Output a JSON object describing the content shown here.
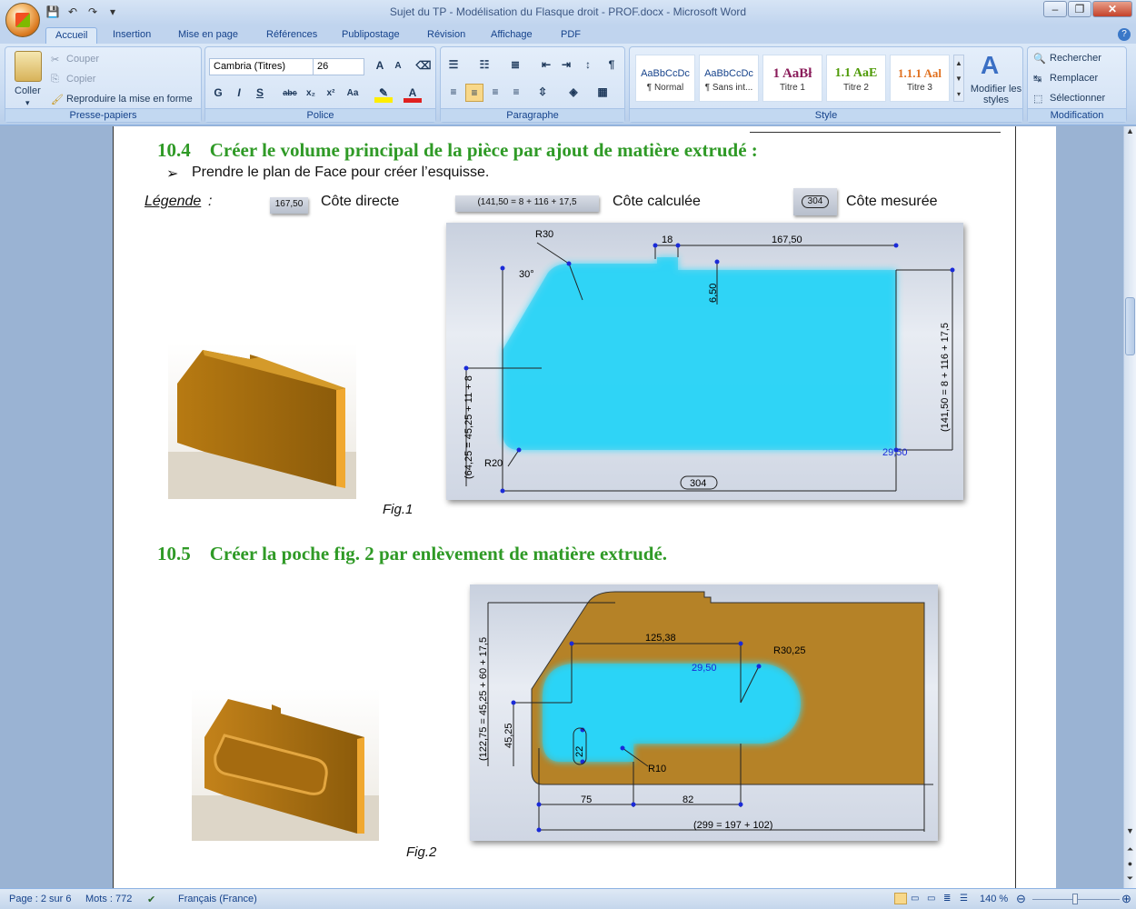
{
  "window": {
    "title": "Sujet du TP - Modélisation du Flasque droit - PROF.docx - Microsoft Word"
  },
  "tabs": [
    "Accueil",
    "Insertion",
    "Mise en page",
    "Références",
    "Publipostage",
    "Révision",
    "Affichage",
    "PDF"
  ],
  "ribbon": {
    "clipboard": {
      "label": "Presse-papiers",
      "paste": "Coller",
      "cut": "Couper",
      "copy": "Copier",
      "format_painter": "Reproduire la mise en forme"
    },
    "font": {
      "label": "Police",
      "family": "Cambria (Titres)",
      "size": "26"
    },
    "paragraph": {
      "label": "Paragraphe"
    },
    "styles": {
      "label": "Style",
      "items": [
        {
          "preview": "AaBbCcDc",
          "name": "¶ Normal",
          "color": "#000000"
        },
        {
          "preview": "AaBbCcDc",
          "name": "¶ Sans int...",
          "color": "#000000"
        },
        {
          "preview": "1  AaBł",
          "name": "Titre 1",
          "color": "#8a1c5a"
        },
        {
          "preview": "1.1  AaE",
          "name": "Titre 2",
          "color": "#4e9a06"
        },
        {
          "preview": "1.1.1  Aal",
          "name": "Titre 3",
          "color": "#e07020"
        }
      ],
      "modify": "Modifier les styles"
    },
    "editing": {
      "label": "Modification",
      "find": "Rechercher",
      "replace": "Remplacer",
      "select": "Sélectionner"
    }
  },
  "doc": {
    "h1": {
      "num": "10.4",
      "text": "Créer le volume principal de la pièce par ajout de matière extrudé :"
    },
    "bullet": "Prendre le plan de Face pour créer l’esquisse.",
    "legend": {
      "title": "Légende",
      "colon": ":",
      "direct_box": "167,50",
      "direct": "Côte directe",
      "calc_box": "(141,50 = 8 + 116 + 17,5",
      "calc": "Côte calculée",
      "meas_box": "304",
      "meas": "Côte mesurée"
    },
    "fig1": {
      "caption": "Fig.1",
      "dims": {
        "r30": "R30",
        "d18": "18",
        "d167": "167,50",
        "d30deg": "30°",
        "d650": "6,50",
        "left": "(64,25 = 45,25 + 11 + 8",
        "right": "(141,50 = 8 + 116 + 17,5",
        "r20": "R20",
        "d2950": "29,50",
        "d304": "304"
      }
    },
    "h2": {
      "num": "10.5",
      "text": "Créer la poche fig. 2 par enlèvement de matière extrudé."
    },
    "fig2": {
      "caption": "Fig.2",
      "dims": {
        "d12538": "125,38",
        "r3025": "R30,25",
        "d2950": "29,50",
        "left": "(122,75 = 45,25 + 60 + 17,5",
        "d4525": "45,25",
        "d22": "22",
        "r10": "R10",
        "d75": "75",
        "d82": "82",
        "bottom": "(299 = 197 + 102)"
      }
    }
  },
  "status": {
    "page": "Page : 2 sur 6",
    "words": "Mots : 772",
    "lang": "Français (France)",
    "zoom": "140 %"
  }
}
